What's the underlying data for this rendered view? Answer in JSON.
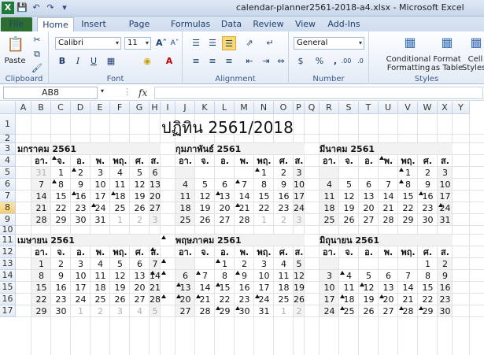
{
  "window": {
    "title": "calendar-planner2561-2018-a4.xlsx - Microsoft Excel"
  },
  "ribbon_tabs": [
    "File",
    "Home",
    "Insert",
    "Page Layout",
    "Formulas",
    "Data",
    "Review",
    "View",
    "Add-Ins"
  ],
  "ribbon": {
    "clipboard": {
      "label": "Clipboard",
      "paste": "Paste"
    },
    "font": {
      "label": "Font",
      "name": "Calibri",
      "size": "11"
    },
    "alignment": {
      "label": "Alignment"
    },
    "number": {
      "label": "Number",
      "format": "General",
      "percent": "%"
    },
    "styles": {
      "label": "Styles",
      "cond_fmt_1": "Conditional",
      "cond_fmt_2": "Formatting",
      "fmt_table_1": "Format",
      "fmt_table_2": "as Table",
      "cell_styles_1": "Cell",
      "cell_styles_2": "Styles"
    }
  },
  "formula_bar": {
    "name_box": "AB8",
    "fx": "fx"
  },
  "columns": [
    "A",
    "B",
    "C",
    "D",
    "E",
    "F",
    "G",
    "H",
    "I",
    "J",
    "K",
    "L",
    "M",
    "N",
    "O",
    "P",
    "Q",
    "R",
    "S",
    "T",
    "U",
    "V",
    "W",
    "X",
    "Y"
  ],
  "rows": [
    "1",
    "2",
    "3",
    "4",
    "5",
    "6",
    "7",
    "8",
    "9",
    "10",
    "11",
    "12",
    "13",
    "14",
    "15",
    "16",
    "17"
  ],
  "selected_row": "8",
  "sheet": {
    "title": "ปฏิทิน   2561/2018",
    "weekdays": [
      "อา.",
      "จ.",
      "อ.",
      "พ.",
      "พฤ.",
      "ศ.",
      "ส."
    ],
    "months": [
      {
        "name": "มกราคม 2561",
        "weeks": [
          [
            "31",
            "1",
            "2",
            "3",
            "4",
            "5",
            "6"
          ],
          [
            "7",
            "8",
            "9",
            "10",
            "11",
            "12",
            "13"
          ],
          [
            "14",
            "15",
            "16",
            "17",
            "18",
            "19",
            "20"
          ],
          [
            "21",
            "22",
            "23",
            "24",
            "25",
            "26",
            "27"
          ],
          [
            "28",
            "29",
            "30",
            "31",
            "1",
            "2",
            "3"
          ]
        ]
      },
      {
        "name": "กุมภาพันธ์ 2561",
        "weeks": [
          [
            "",
            "",
            "",
            "",
            "1",
            "2",
            "3"
          ],
          [
            "4",
            "5",
            "6",
            "7",
            "8",
            "9",
            "10"
          ],
          [
            "11",
            "12",
            "13",
            "14",
            "15",
            "16",
            "17"
          ],
          [
            "18",
            "19",
            "20",
            "21",
            "22",
            "23",
            "24"
          ],
          [
            "25",
            "26",
            "27",
            "28",
            "1",
            "2",
            "3"
          ]
        ]
      },
      {
        "name": "มีนาคม 2561",
        "weeks": [
          [
            "",
            "",
            "",
            "",
            "1",
            "2",
            "3"
          ],
          [
            "4",
            "5",
            "6",
            "7",
            "8",
            "9",
            "10"
          ],
          [
            "11",
            "12",
            "13",
            "14",
            "15",
            "16",
            "17"
          ],
          [
            "18",
            "19",
            "20",
            "21",
            "22",
            "23",
            "24"
          ],
          [
            "25",
            "26",
            "27",
            "28",
            "29",
            "30",
            "31"
          ]
        ]
      },
      {
        "name": "เมษายน 2561",
        "weeks": [
          [
            "1",
            "2",
            "3",
            "4",
            "5",
            "6",
            "7"
          ],
          [
            "8",
            "9",
            "10",
            "11",
            "12",
            "13",
            "14"
          ],
          [
            "15",
            "16",
            "17",
            "18",
            "19",
            "20",
            "21"
          ],
          [
            "22",
            "23",
            "24",
            "25",
            "26",
            "27",
            "28"
          ],
          [
            "29",
            "30",
            "1",
            "2",
            "3",
            "4",
            "5"
          ]
        ]
      },
      {
        "name": "พฤษภาคม 2561",
        "weeks": [
          [
            "",
            "",
            "1",
            "2",
            "3",
            "4",
            "5"
          ],
          [
            "6",
            "7",
            "8",
            "9",
            "10",
            "11",
            "12"
          ],
          [
            "13",
            "14",
            "15",
            "16",
            "17",
            "18",
            "19"
          ],
          [
            "20",
            "21",
            "22",
            "23",
            "24",
            "25",
            "26"
          ],
          [
            "27",
            "28",
            "29",
            "30",
            "31",
            "1",
            "2"
          ]
        ]
      },
      {
        "name": "มิถุนายน 2561",
        "weeks": [
          [
            "",
            "",
            "",
            "",
            "",
            "1",
            "2"
          ],
          [
            "3",
            "4",
            "5",
            "6",
            "7",
            "8",
            "9"
          ],
          [
            "10",
            "11",
            "12",
            "13",
            "14",
            "15",
            "16"
          ],
          [
            "17",
            "18",
            "19",
            "20",
            "21",
            "22",
            "23"
          ],
          [
            "24",
            "25",
            "26",
            "27",
            "28",
            "29",
            "30"
          ]
        ]
      }
    ]
  }
}
